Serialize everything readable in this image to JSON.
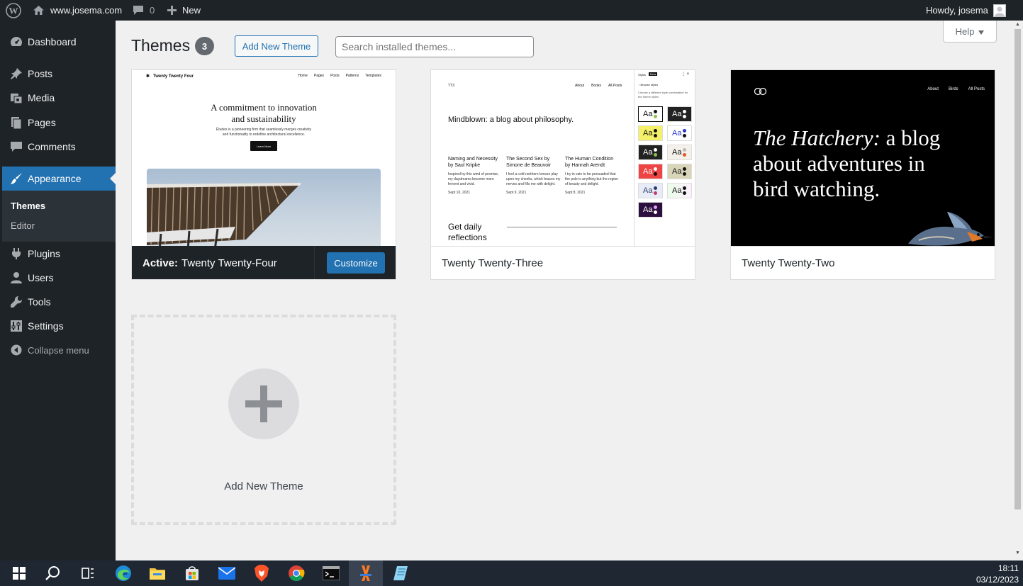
{
  "adminbar": {
    "site_name": "www.josema.com",
    "comments_count": "0",
    "new_label": "New",
    "howdy": "Howdy, josema"
  },
  "sidebar": {
    "dashboard": "Dashboard",
    "posts": "Posts",
    "media": "Media",
    "pages": "Pages",
    "comments": "Comments",
    "appearance": "Appearance",
    "sub_themes": "Themes",
    "sub_editor": "Editor",
    "plugins": "Plugins",
    "users": "Users",
    "tools": "Tools",
    "settings": "Settings",
    "collapse": "Collapse menu"
  },
  "header": {
    "title": "Themes",
    "count": "3",
    "add_new_button": "Add New Theme",
    "search_placeholder": "Search installed themes...",
    "help": "Help"
  },
  "themes": [
    {
      "name": "Twenty Twenty-Four",
      "active_prefix": "Active:",
      "customize": "Customize",
      "preview": {
        "brand": "Twenty Twenty Four",
        "nav": [
          "Home",
          "Pages",
          "Posts",
          "Patterns",
          "Templates"
        ],
        "headline_1": "A commitment to innovation",
        "headline_2": "and sustainability",
        "body_1": "Études is a pioneering firm that seamlessly merges creativity",
        "body_2": "and functionality to redefine architectural excellence.",
        "cta": "Learn More"
      }
    },
    {
      "name": "Twenty Twenty-Three",
      "preview": {
        "brand": "TT3",
        "nav": [
          "About",
          "Books",
          "All Posts"
        ],
        "headline": "Mindblown: a blog about philosophy.",
        "posts": [
          {
            "title_1": "Naming and Necessity",
            "title_2": "by Saul Kripke",
            "excerpt_1": "Inspired by this wind of promise,",
            "excerpt_2": "my daydreams become more",
            "excerpt_3": "fervent and vivid.",
            "date": "Sept 10, 2021"
          },
          {
            "title_1": "The Second Sex by",
            "title_2": "Simone de Beauvoir",
            "excerpt_1": "I feel a cold northern breeze play",
            "excerpt_2": "upon my cheeks, which braces my",
            "excerpt_3": "nerves and fills me with delight.",
            "date": "Sept 9, 2021"
          },
          {
            "title_1": "The Human Condition",
            "title_2": "by Hannah Arendt",
            "excerpt_1": "I try in vain to be persuaded that",
            "excerpt_2": "the pole is anything but the region",
            "excerpt_3": "of beauty and delight.",
            "date": "Sept 8, 2021"
          }
        ],
        "footer_1": "Get daily",
        "footer_2": "reflections",
        "styles_panel": {
          "tab_styles": "Styles",
          "tab_beta": "Beta",
          "browse": "Browse styles",
          "hint_1": "Choose a different style combination for",
          "hint_2": "the theme styles",
          "swatch_label": "Aa"
        }
      }
    },
    {
      "name": "Twenty Twenty-Two",
      "preview": {
        "nav": [
          "About",
          "Birds",
          "All Posts"
        ],
        "headline_em": "The Hatchery:",
        "headline_rest_1": " a blog",
        "headline_2": "about adventures in",
        "headline_3": "bird watching."
      }
    }
  ],
  "add_new_card": {
    "label": "Add New Theme"
  },
  "taskbar": {
    "time": "18:11",
    "date": "03/12/2023"
  },
  "colors": {
    "admin_dark": "#1d2327",
    "accent": "#2271b1",
    "page_bg": "#f0f0f1"
  }
}
